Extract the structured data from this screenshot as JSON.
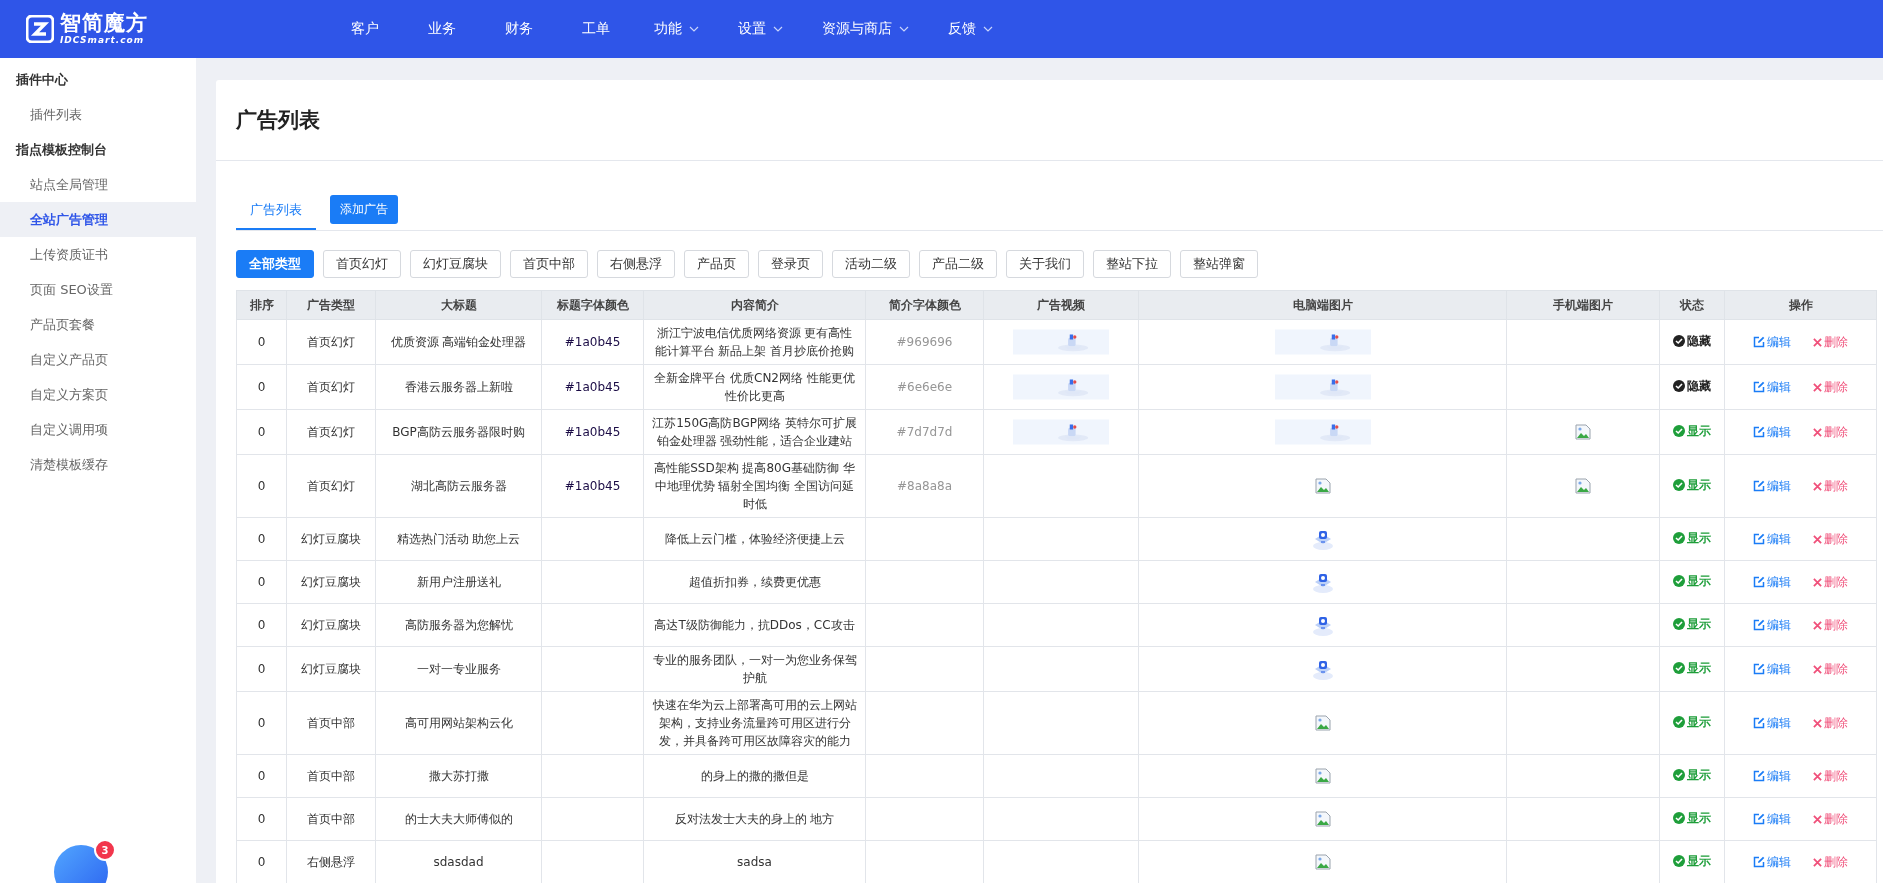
{
  "brand": {
    "name": "智简魔方",
    "domain": "IDCSmart.com"
  },
  "nav": [
    {
      "label": "客户",
      "dropdown": false
    },
    {
      "label": "业务",
      "dropdown": false
    },
    {
      "label": "财务",
      "dropdown": false
    },
    {
      "label": "工单",
      "dropdown": false
    },
    {
      "label": "功能",
      "dropdown": true
    },
    {
      "label": "设置",
      "dropdown": true
    },
    {
      "label": "资源与商店",
      "dropdown": true
    },
    {
      "label": "反馈",
      "dropdown": true
    }
  ],
  "sidebar": [
    {
      "heading": "插件中心",
      "items": [
        {
          "label": "插件列表",
          "selected": false
        }
      ]
    },
    {
      "heading": "指点模板控制台",
      "items": [
        {
          "label": "站点全局管理",
          "selected": false
        },
        {
          "label": "全站广告管理",
          "selected": true
        },
        {
          "label": "上传资质证书",
          "selected": false
        },
        {
          "label": "页面 SEO设置",
          "selected": false
        },
        {
          "label": "产品页套餐",
          "selected": false
        },
        {
          "label": "自定义产品页",
          "selected": false
        },
        {
          "label": "自定义方案页",
          "selected": false
        },
        {
          "label": "自定义调用项",
          "selected": false
        },
        {
          "label": "清楚模板缓存",
          "selected": false
        }
      ]
    }
  ],
  "assistant": {
    "badge": "3"
  },
  "page_title": "广告列表",
  "tabs": [
    {
      "label": "广告列表",
      "kind": "tab",
      "selected": true
    },
    {
      "label": "添加广告",
      "kind": "button",
      "selected": false
    }
  ],
  "filters": [
    {
      "label": "全部类型",
      "selected": true
    },
    {
      "label": "首页幻灯",
      "selected": false
    },
    {
      "label": "幻灯豆腐块",
      "selected": false
    },
    {
      "label": "首页中部",
      "selected": false
    },
    {
      "label": "右侧悬浮",
      "selected": false
    },
    {
      "label": "产品页",
      "selected": false
    },
    {
      "label": "登录页",
      "selected": false
    },
    {
      "label": "活动二级",
      "selected": false
    },
    {
      "label": "产品二级",
      "selected": false
    },
    {
      "label": "关于我们",
      "selected": false
    },
    {
      "label": "整站下拉",
      "selected": false
    },
    {
      "label": "整站弹窗",
      "selected": false
    }
  ],
  "table": {
    "columns": [
      "排序",
      "广告类型",
      "大标题",
      "标题字体颜色",
      "内容简介",
      "简介字体颜色",
      "广告视频",
      "电脑端图片",
      "手机端图片",
      "状态",
      "操作"
    ],
    "rows": [
      {
        "order": "0",
        "type": "首页幻灯",
        "title": "优质资源 高端铂金处理器",
        "title_color": "#1a0b45",
        "intro": "浙江宁波电信优质网络资源 更有高性能计算平台 新品上架 首月抄底价抢购",
        "intro_color": "#969696",
        "video": {
          "kind": "banner"
        },
        "pc_image": {
          "kind": "banner"
        },
        "status": {
          "text": "隐藏",
          "visible": false
        },
        "edit": "编辑",
        "delete": "删除"
      },
      {
        "order": "0",
        "type": "首页幻灯",
        "title": "香港云服务器上新啦",
        "title_color": "#1a0b45",
        "intro": "全新金牌平台 优质CN2网络 性能更优性价比更高",
        "intro_color": "#6e6e6e",
        "video": {
          "kind": "banner"
        },
        "pc_image": {
          "kind": "banner"
        },
        "status": {
          "text": "隐藏",
          "visible": false
        },
        "edit": "编辑",
        "delete": "删除"
      },
      {
        "order": "0",
        "type": "首页幻灯",
        "title": "BGP高防云服务器限时购",
        "title_color": "#1a0b45",
        "intro": "江苏150G高防BGP网络 英特尔可扩展铂金处理器 强劲性能，适合企业建站",
        "intro_color": "#7d7d7d",
        "video": {
          "kind": "banner"
        },
        "pc_image": {
          "kind": "banner"
        },
        "mobile_image": {
          "kind": "broken"
        },
        "status": {
          "text": "显示",
          "visible": true
        },
        "edit": "编辑",
        "delete": "删除"
      },
      {
        "order": "0",
        "type": "首页幻灯",
        "title": "湖北高防云服务器",
        "title_color": "#1a0b45",
        "intro": "高性能SSD架构 提高80G基础防御 华中地理优势 辐射全国均衡 全国访问延时低",
        "intro_color": "#8a8a8a",
        "pc_image": {
          "kind": "broken"
        },
        "mobile_image": {
          "kind": "broken"
        },
        "status": {
          "text": "显示",
          "visible": true
        },
        "edit": "编辑",
        "delete": "删除"
      },
      {
        "order": "0",
        "type": "幻灯豆腐块",
        "title": "精选热门活动 助您上云",
        "intro": "降低上云门槛，体验经济便捷上云",
        "pc_image": {
          "kind": "icon"
        },
        "status": {
          "text": "显示",
          "visible": true
        },
        "edit": "编辑",
        "delete": "删除"
      },
      {
        "order": "0",
        "type": "幻灯豆腐块",
        "title": "新用户注册送礼",
        "intro": "超值折扣券，续费更优惠",
        "pc_image": {
          "kind": "icon"
        },
        "status": {
          "text": "显示",
          "visible": true
        },
        "edit": "编辑",
        "delete": "删除"
      },
      {
        "order": "0",
        "type": "幻灯豆腐块",
        "title": "高防服务器为您解忧",
        "intro": "高达T级防御能力，抗DDos，CC攻击",
        "pc_image": {
          "kind": "icon"
        },
        "status": {
          "text": "显示",
          "visible": true
        },
        "edit": "编辑",
        "delete": "删除"
      },
      {
        "order": "0",
        "type": "幻灯豆腐块",
        "title": "一对一专业服务",
        "intro": "专业的服务团队，一对一为您业务保驾护航",
        "pc_image": {
          "kind": "icon"
        },
        "status": {
          "text": "显示",
          "visible": true
        },
        "edit": "编辑",
        "delete": "删除"
      },
      {
        "order": "0",
        "type": "首页中部",
        "title": "高可用网站架构云化",
        "intro": "快速在华为云上部署高可用的云上网站架构，支持业务流量跨可用区进行分发，并具备跨可用区故障容灾的能力",
        "pc_image": {
          "kind": "broken"
        },
        "status": {
          "text": "显示",
          "visible": true
        },
        "edit": "编辑",
        "delete": "删除"
      },
      {
        "order": "0",
        "type": "首页中部",
        "title": "撒大苏打撒",
        "intro": "的身上的撒的撒但是",
        "pc_image": {
          "kind": "broken"
        },
        "status": {
          "text": "显示",
          "visible": true
        },
        "edit": "编辑",
        "delete": "删除"
      },
      {
        "order": "0",
        "type": "首页中部",
        "title": "的士大夫大师傅似的",
        "intro": "反对法发士大夫的身上的 地方",
        "pc_image": {
          "kind": "broken"
        },
        "status": {
          "text": "显示",
          "visible": true
        },
        "edit": "编辑",
        "delete": "删除"
      },
      {
        "order": "0",
        "type": "右侧悬浮",
        "title": "sdasdad",
        "intro": "sadsa",
        "pc_image": {
          "kind": "broken"
        },
        "status": {
          "text": "显示",
          "visible": true
        },
        "edit": "编辑",
        "delete": "删除"
      }
    ]
  }
}
